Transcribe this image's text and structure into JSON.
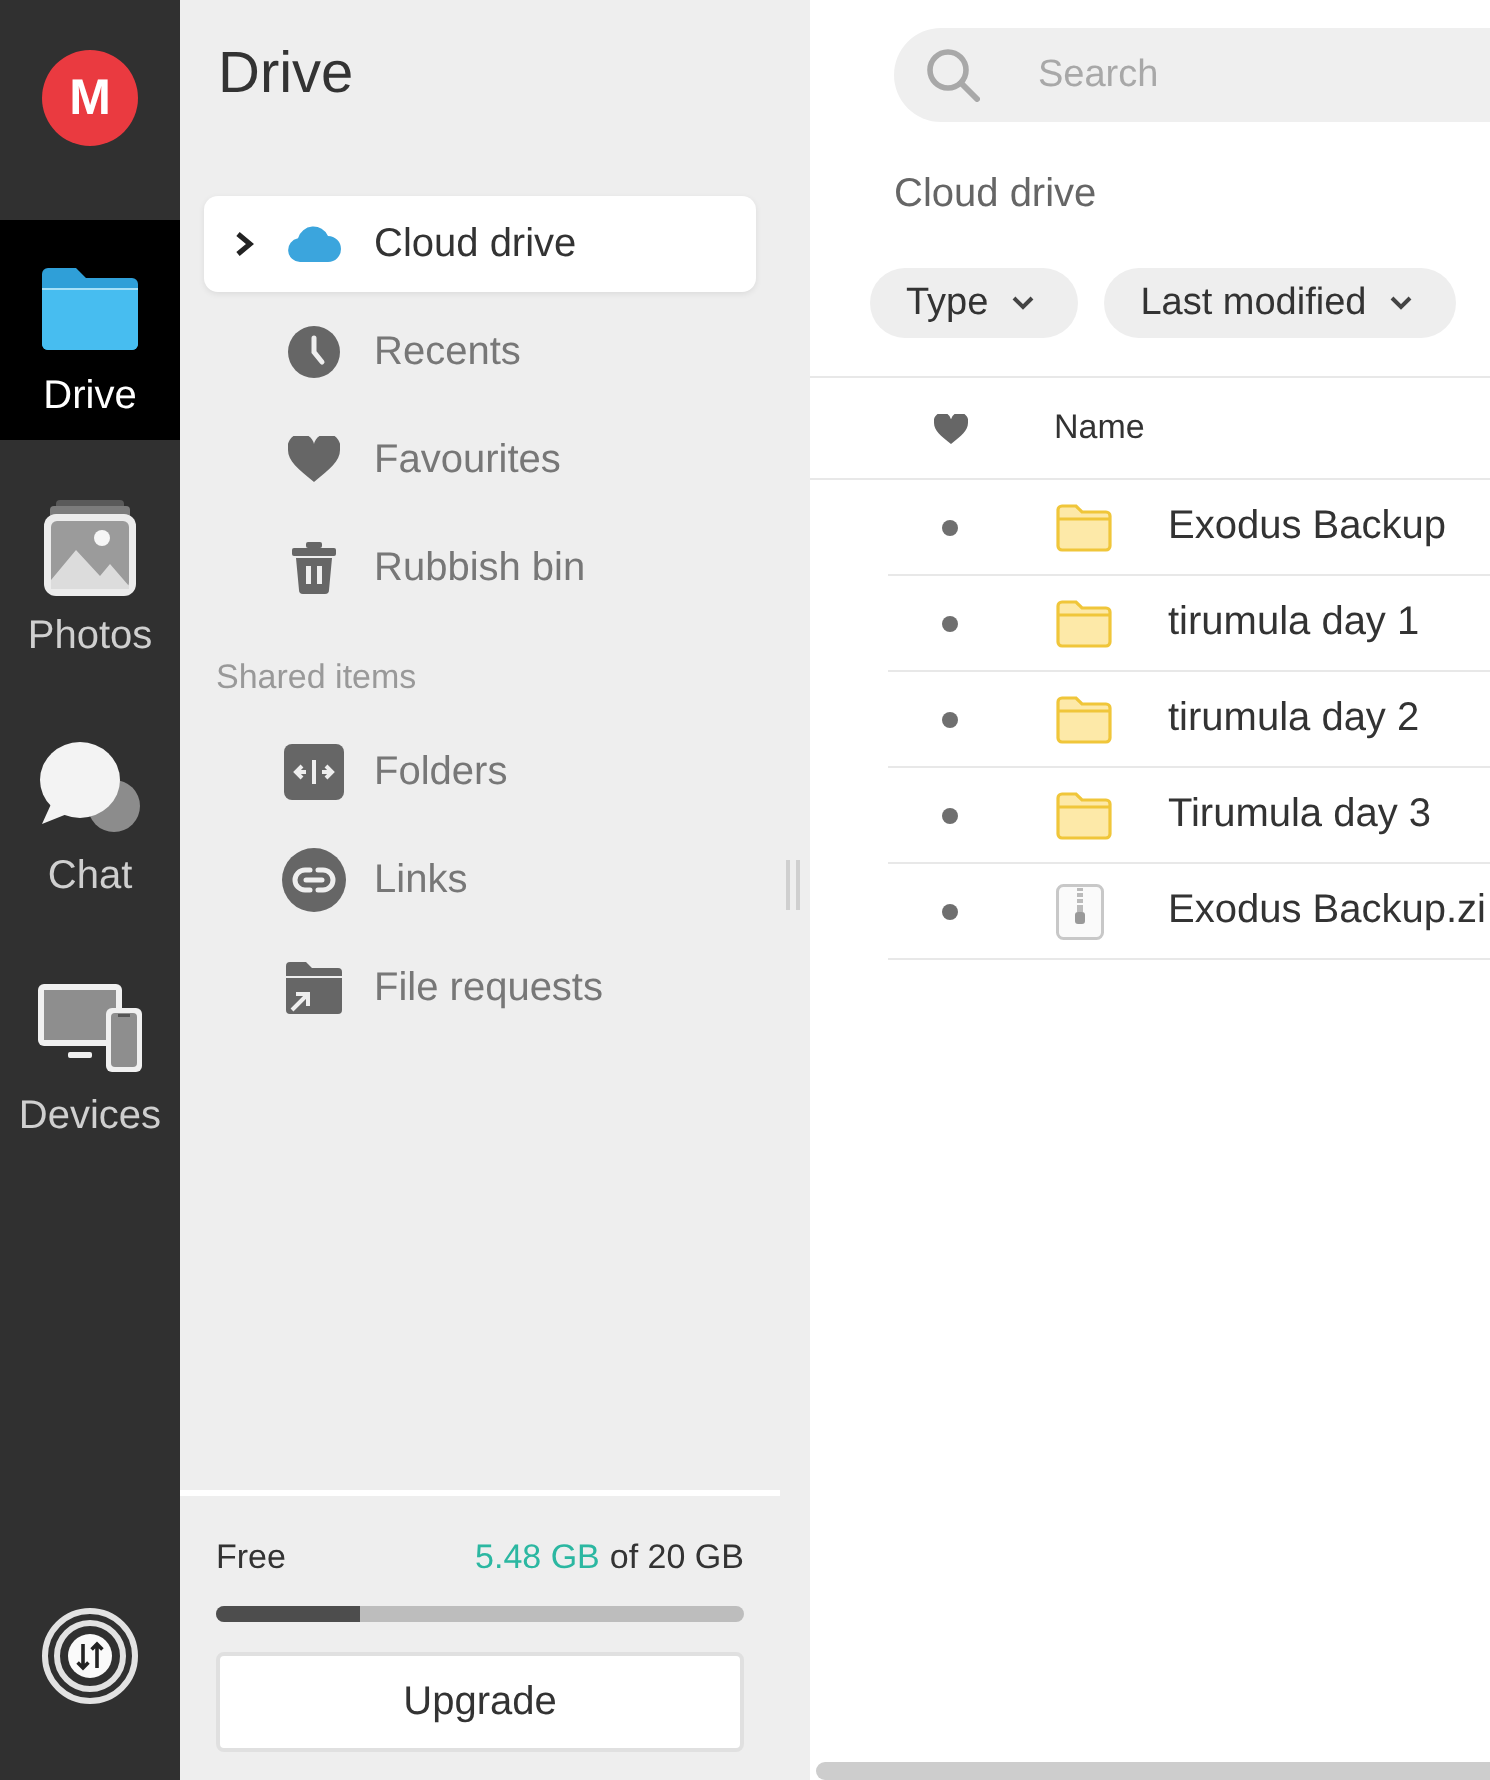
{
  "rail": {
    "logo": "M",
    "items": [
      {
        "kind": "drive",
        "label": "Drive",
        "selected": true
      },
      {
        "kind": "photos",
        "label": "Photos",
        "selected": false
      },
      {
        "kind": "chat",
        "label": "Chat",
        "selected": false
      },
      {
        "kind": "devices",
        "label": "Devices",
        "selected": false
      }
    ]
  },
  "sidebar": {
    "title": "Drive",
    "items": [
      {
        "kind": "cloud",
        "label": "Cloud drive",
        "selected": true,
        "expanded": false
      },
      {
        "kind": "recents",
        "label": "Recents",
        "selected": false
      },
      {
        "kind": "favourites",
        "label": "Favourites",
        "selected": false
      },
      {
        "kind": "rubbish",
        "label": "Rubbish bin",
        "selected": false
      }
    ],
    "sections": [
      {
        "heading": "Shared items",
        "items": [
          {
            "kind": "folders",
            "label": "Folders",
            "selected": false
          },
          {
            "kind": "links",
            "label": "Links",
            "selected": false
          },
          {
            "kind": "file_requests",
            "label": "File requests",
            "selected": false
          }
        ]
      }
    ],
    "storage": {
      "label": "Free",
      "used": "5.48 GB",
      "total": "of 20 GB",
      "level": 0.274
    },
    "upgrade_button": "Upgrade"
  },
  "main": {
    "search": {
      "placeholder": "Search"
    },
    "breadcrumb": "Cloud drive",
    "filters": [
      {
        "label": "Type"
      },
      {
        "label": "Last modified"
      }
    ],
    "table": {
      "name_header": "Name",
      "rows": [
        {
          "kind": "folder",
          "name": "Exodus Backup"
        },
        {
          "kind": "folder",
          "name": "tirumula day 1"
        },
        {
          "kind": "folder",
          "name": "tirumula day 2"
        },
        {
          "kind": "folder",
          "name": "Tirumula day 3"
        },
        {
          "kind": "archive",
          "name": "Exodus Backup.zi"
        }
      ]
    }
  }
}
